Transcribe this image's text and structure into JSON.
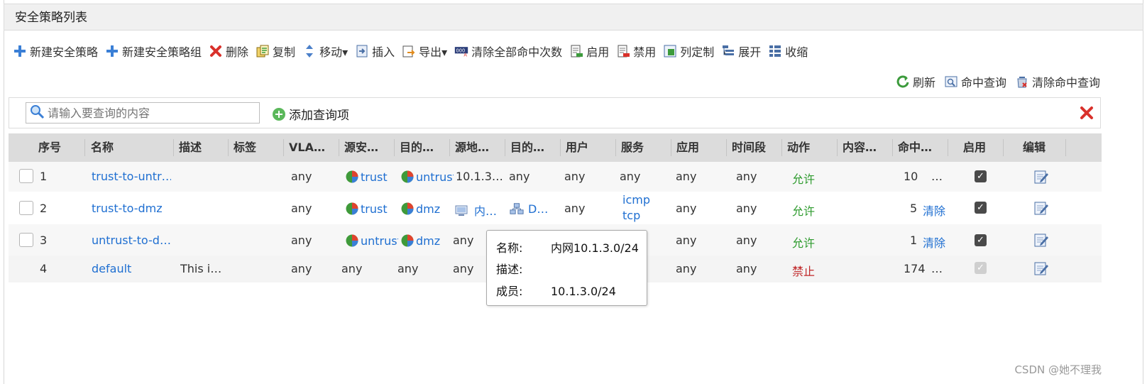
{
  "panel": {
    "title": "安全策略列表"
  },
  "toolbar": [
    {
      "label": "新建安全策略",
      "icon": "plus-icon"
    },
    {
      "label": "新建安全策略组",
      "icon": "plus-icon"
    },
    {
      "label": "删除",
      "icon": "delete-x-icon"
    },
    {
      "label": "复制",
      "icon": "copy-icon"
    },
    {
      "label": "移动▾",
      "icon": "move-icon"
    },
    {
      "label": "插入",
      "icon": "insert-icon"
    },
    {
      "label": "导出▾",
      "icon": "export-icon"
    },
    {
      "label": "清除全部命中次数",
      "icon": "clear-hits-icon"
    },
    {
      "label": "启用",
      "icon": "enable-icon"
    },
    {
      "label": "禁用",
      "icon": "disable-icon"
    },
    {
      "label": "列定制",
      "icon": "column-custom-icon"
    },
    {
      "label": "展开",
      "icon": "expand-icon"
    },
    {
      "label": "收缩",
      "icon": "collapse-icon"
    }
  ],
  "toolbar2": [
    {
      "label": "刷新",
      "icon": "refresh-icon"
    },
    {
      "label": "命中查询",
      "icon": "hit-query-icon"
    },
    {
      "label": "清除命中查询",
      "icon": "clear-hit-query-icon"
    }
  ],
  "search": {
    "placeholder": "请输入要查询的内容",
    "add_label": "添加查询项"
  },
  "table": {
    "headers": [
      "序号",
      "名称",
      "描述",
      "标签",
      "VLA…",
      "源安…",
      "目的…",
      "源地…",
      "目的…",
      "用户",
      "服务",
      "应用",
      "时间段",
      "动作",
      "内容…",
      "命中…",
      "启用",
      "编辑"
    ],
    "rows": [
      {
        "seq": "1",
        "name": "trust-to-untr…",
        "desc": "",
        "vlan": "any",
        "src_zone": "trust",
        "dst_zone": "untrust",
        "src_addr": "10.1.3…",
        "dst_addr": "any",
        "user": "any",
        "service": [
          "any"
        ],
        "app": "any",
        "time": "any",
        "action": "允许",
        "hits": "10",
        "hits_suffix": "…",
        "enabled": true
      },
      {
        "seq": "2",
        "name": "trust-to-dmz",
        "desc": "",
        "vlan": "any",
        "src_zone": "trust",
        "dst_zone": "dmz",
        "src_addr": "内…",
        "dst_addr": "D…",
        "user": "any",
        "service": [
          "icmp",
          "tcp"
        ],
        "app": "any",
        "time": "any",
        "action": "允许",
        "hits": "5",
        "hits_suffix": "清除",
        "enabled": true
      },
      {
        "seq": "3",
        "name": "untrust-to-d…",
        "desc": "",
        "vlan": "any",
        "src_zone": "untrust",
        "dst_zone": "dmz",
        "src_addr": "any",
        "dst_addr": "",
        "user": "",
        "service": [],
        "app": "any",
        "time": "any",
        "action": "允许",
        "hits": "1",
        "hits_suffix": "清除",
        "enabled": true
      },
      {
        "seq": "4",
        "name": "default",
        "desc": "This i…",
        "vlan": "any",
        "src_zone": "any",
        "dst_zone": "any",
        "src_addr": "any",
        "dst_addr": "",
        "user": "",
        "service": [],
        "app": "any",
        "time": "any",
        "action": "禁止",
        "hits": "174",
        "hits_suffix": "…",
        "enabled": true
      }
    ]
  },
  "tooltip": {
    "name_label": "名称:",
    "name_value": "内网10.1.3.0/24",
    "desc_label": "描述:",
    "desc_value": "",
    "member_label": "成员:",
    "member_value": "10.1.3.0/24"
  },
  "watermark": "CSDN @她不理我",
  "colors": {
    "link": "#1f6fd1",
    "allow": "#2e9b2e",
    "deny": "#c0282a",
    "header_bg": "#dcdcdc"
  }
}
